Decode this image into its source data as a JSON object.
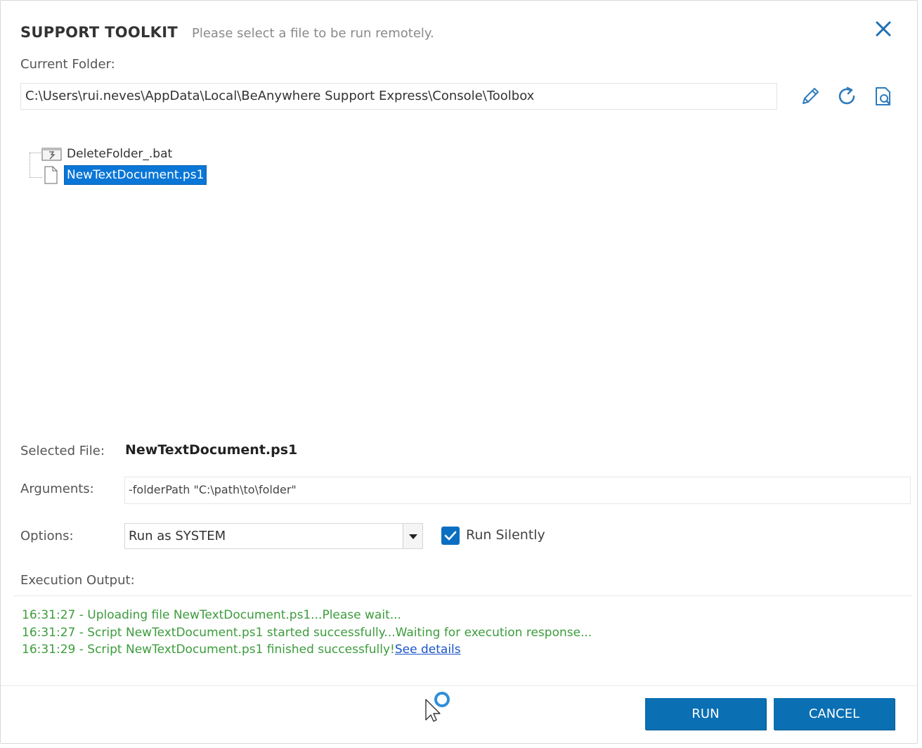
{
  "dialog": {
    "title": "SUPPORT TOOLKIT",
    "subtitle": "Please select a file to be run remotely."
  },
  "folder": {
    "label": "Current Folder:",
    "path": "C:\\Users\\rui.neves\\AppData\\Local\\BeAnywhere Support Express\\Console\\Toolbox",
    "tools": [
      "edit-icon",
      "refresh-icon",
      "browse-icon"
    ]
  },
  "files": [
    {
      "name": "DeleteFolder_.bat",
      "icon": "batch-file-icon",
      "selected": false
    },
    {
      "name": "NewTextDocument.ps1",
      "icon": "text-file-icon",
      "selected": true
    }
  ],
  "selected_file": {
    "label": "Selected File:",
    "value": "NewTextDocument.ps1"
  },
  "arguments": {
    "label": "Arguments:",
    "value": "-folderPath \"C:\\path\\to\\folder\""
  },
  "options": {
    "label": "Options:",
    "run_as": "Run as SYSTEM",
    "run_silently_label": "Run Silently",
    "run_silently_checked": true
  },
  "execution_output": {
    "label": "Execution Output:",
    "lines": [
      "16:31:27 - Uploading file NewTextDocument.ps1...Please wait...",
      "16:31:27 - Script NewTextDocument.ps1 started successfully...Waiting for execution response...",
      "16:31:29 - Script NewTextDocument.ps1 finished successfully!"
    ],
    "details_link": "See details",
    "text_color": "#3c9c3c"
  },
  "buttons": {
    "run": "RUN",
    "cancel": "CANCEL"
  },
  "colors": {
    "accent": "#0a6fb3",
    "selection": "#0a76d6"
  }
}
